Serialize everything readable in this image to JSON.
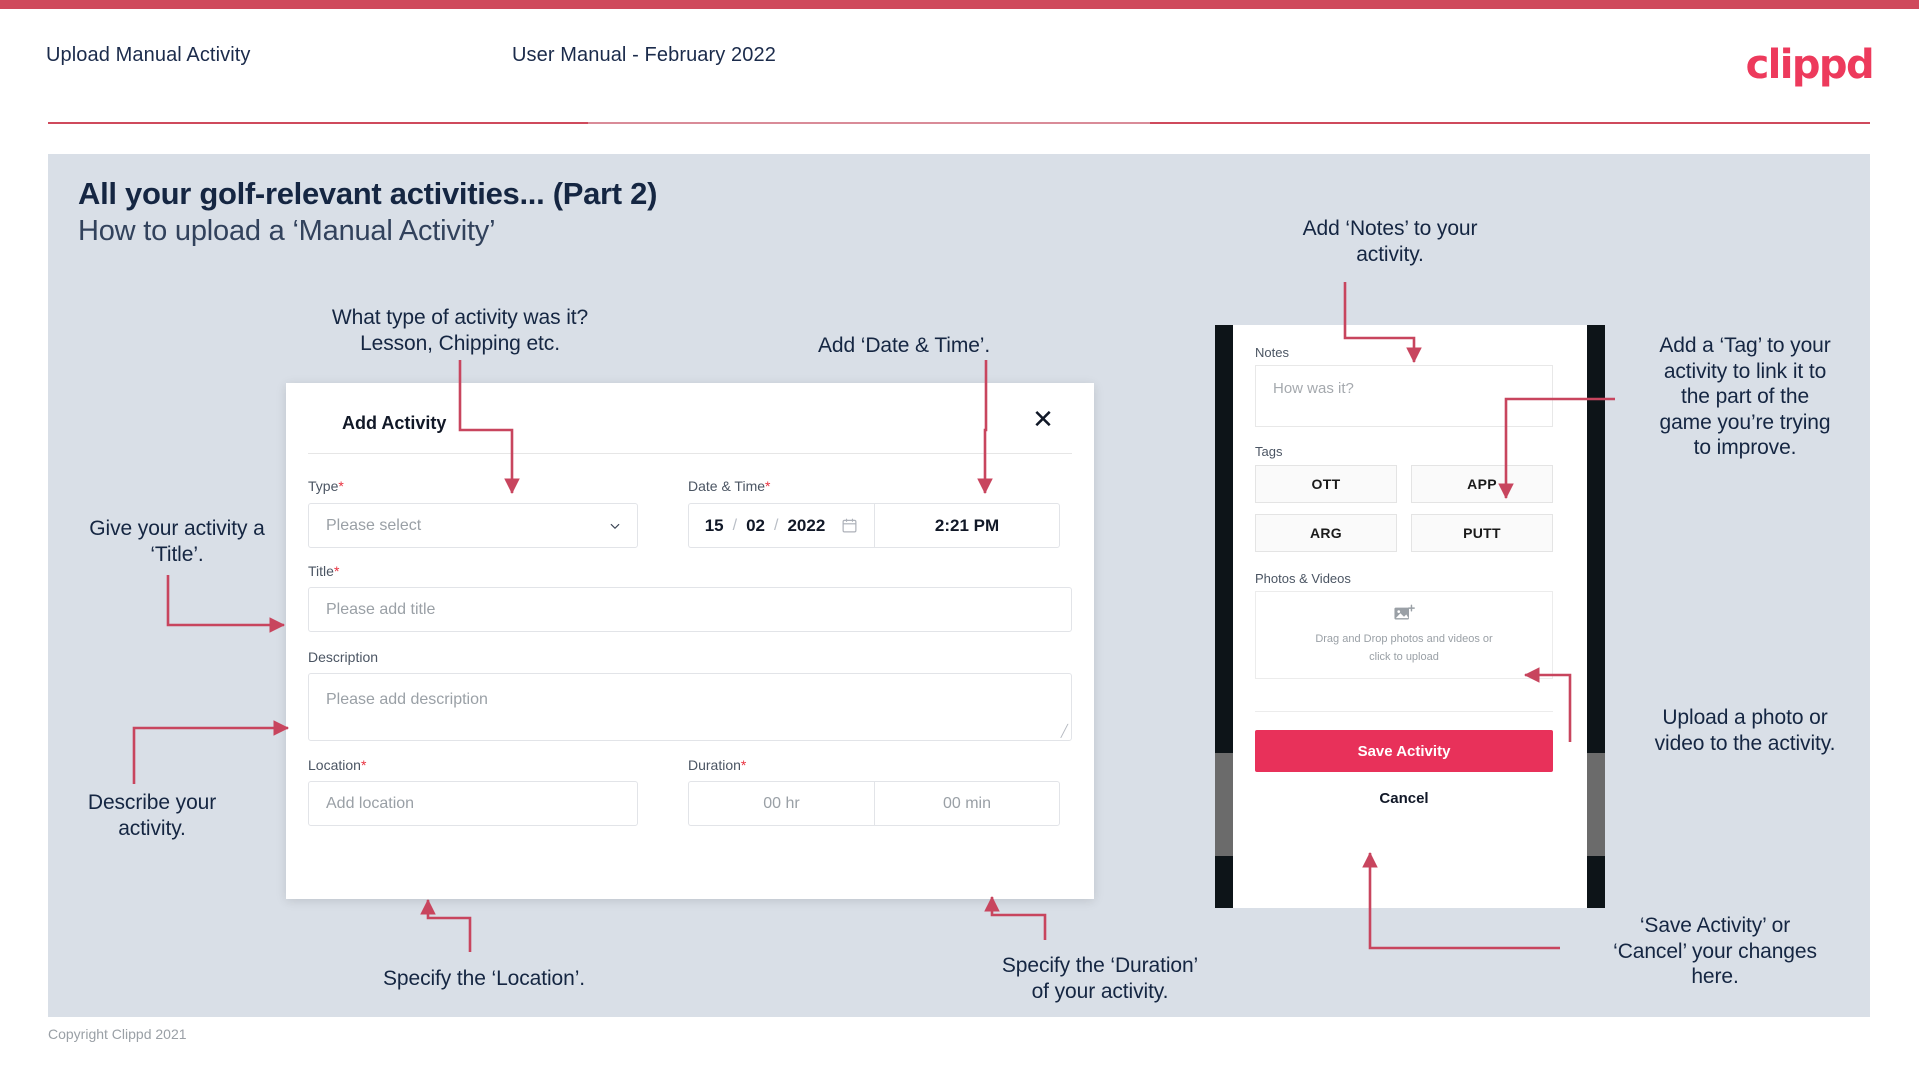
{
  "header": {
    "title": "Upload Manual Activity",
    "subtitle": "User Manual - February 2022",
    "logo": "clippd"
  },
  "slide": {
    "title": "All your golf-relevant activities... (Part 2)",
    "subtitle": "How to upload a ‘Manual Activity’"
  },
  "dialog": {
    "title": "Add Activity",
    "close_icon": "close-icon",
    "type": {
      "label": "Type",
      "required": "*",
      "placeholder": "Please select"
    },
    "datetime": {
      "label": "Date & Time",
      "required": "*",
      "day": "15",
      "month": "02",
      "year": "2022",
      "sep": "/",
      "time": "2:21 PM"
    },
    "title_field": {
      "label": "Title",
      "required": "*",
      "placeholder": "Please add title"
    },
    "description": {
      "label": "Description",
      "placeholder": "Please add description"
    },
    "location": {
      "label": "Location",
      "required": "*",
      "placeholder": "Add location"
    },
    "duration": {
      "label": "Duration",
      "required": "*",
      "hours": "00 hr",
      "minutes": "00 min"
    }
  },
  "phone": {
    "notes": {
      "label": "Notes",
      "placeholder": "How was it?"
    },
    "tags": {
      "label": "Tags",
      "items": [
        "OTT",
        "APP",
        "ARG",
        "PUTT"
      ]
    },
    "photos": {
      "label": "Photos & Videos",
      "drop_line1": "Drag and Drop photos and videos or",
      "drop_line2": "click to upload",
      "icon": "add-image-icon"
    },
    "save_label": "Save Activity",
    "cancel_label": "Cancel"
  },
  "annotations": {
    "type": "What type of activity was it?\nLesson, Chipping etc.",
    "type_l1": "What type of activity was it?",
    "type_l2": "Lesson, Chipping etc.",
    "datetime": "Add ‘Date & Time’.",
    "title_l1": "Give your activity a",
    "title_l2": "‘Title’.",
    "description_l1": "Describe your",
    "description_l2": "activity.",
    "location": "Specify the ‘Location’.",
    "duration_l1": "Specify the ‘Duration’",
    "duration_l2": "of your activity.",
    "notes_l1": "Add ‘Notes’ to your",
    "notes_l2": "activity.",
    "tag_l1": "Add a ‘Tag’ to your",
    "tag_l2": "activity to link it to",
    "tag_l3": "the part of the",
    "tag_l4": "game you’re trying",
    "tag_l5": "to improve.",
    "upload_l1": "Upload a photo or",
    "upload_l2": "video to the activity.",
    "save_l1": "‘Save Activity’ or",
    "save_l2": "‘Cancel’ your changes",
    "save_l3": "here."
  },
  "footer": {
    "copyright": "Copyright Clippd 2021"
  },
  "colors": {
    "brand_red": "#ed3a5c",
    "save_red": "#e8315a",
    "arrow_red": "#c8455e",
    "slide_bg": "#d9dfe7",
    "heading": "#152642",
    "required": "#e8313f"
  }
}
